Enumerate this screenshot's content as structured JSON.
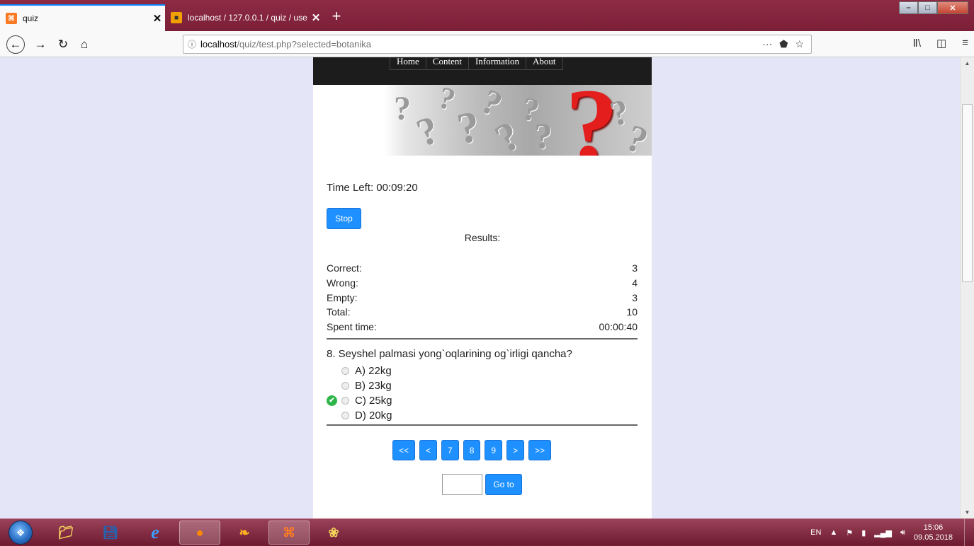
{
  "browser": {
    "tabs": [
      {
        "title": "quiz",
        "favicon": "xampp-icon",
        "close": "✕"
      },
      {
        "title": "localhost / 127.0.0.1 / quiz / use",
        "favicon": "phpmyadmin-icon",
        "close": "✕"
      }
    ],
    "new_tab": "+",
    "url_host": "localhost",
    "url_path": "/quiz/test.php?selected=botanika",
    "url_more": "···"
  },
  "site": {
    "menu": [
      "Home",
      "Content",
      "Information",
      "About"
    ]
  },
  "quiz": {
    "time_left": "Time Left: 00:09:20",
    "stop_label": "Stop",
    "results_title": "Results:",
    "stats": [
      {
        "label": "Correct:",
        "value": "3"
      },
      {
        "label": "Wrong:",
        "value": "4"
      },
      {
        "label": "Empty:",
        "value": "3"
      },
      {
        "label": "Total:",
        "value": "10"
      },
      {
        "label": "Spent time:",
        "value": "00:00:40"
      }
    ],
    "question": "8. Seyshel palmasi yong`oqlarining og`irligi qancha?",
    "options": [
      "A) 22kg",
      "B) 23kg",
      "C) 25kg",
      "D) 20kg"
    ],
    "correct_option": "C) 25kg",
    "pager": [
      "<<",
      "<",
      "7",
      "8",
      "9",
      ">",
      ">>"
    ],
    "goto_label": "Go to",
    "goto_value": ""
  },
  "taskbar": {
    "language": "EN",
    "time": "15:06",
    "date": "09.05.2018"
  },
  "colors": {
    "button_blue": "#1e90ff",
    "page_bg": "#e4e5f7",
    "correct_green": "#2db54a",
    "tab_accent": "#0a84ff"
  }
}
